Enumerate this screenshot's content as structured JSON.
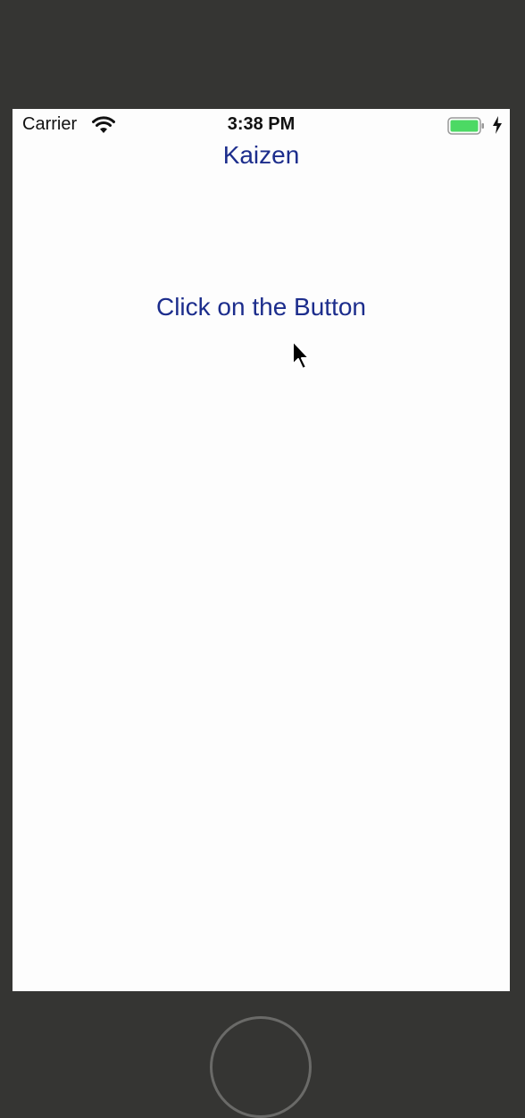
{
  "status_bar": {
    "carrier": "Carrier",
    "time": "3:38 PM",
    "wifi_icon": "wifi-icon",
    "battery_icon": "battery-charging-icon",
    "battery_color": "#4cd964"
  },
  "nav": {
    "title": "Kaizen"
  },
  "main": {
    "button_label": "Click on the Button"
  },
  "colors": {
    "accent": "#1c2d8c",
    "device_frame": "#353533",
    "screen_bg": "#fdfdfd"
  }
}
